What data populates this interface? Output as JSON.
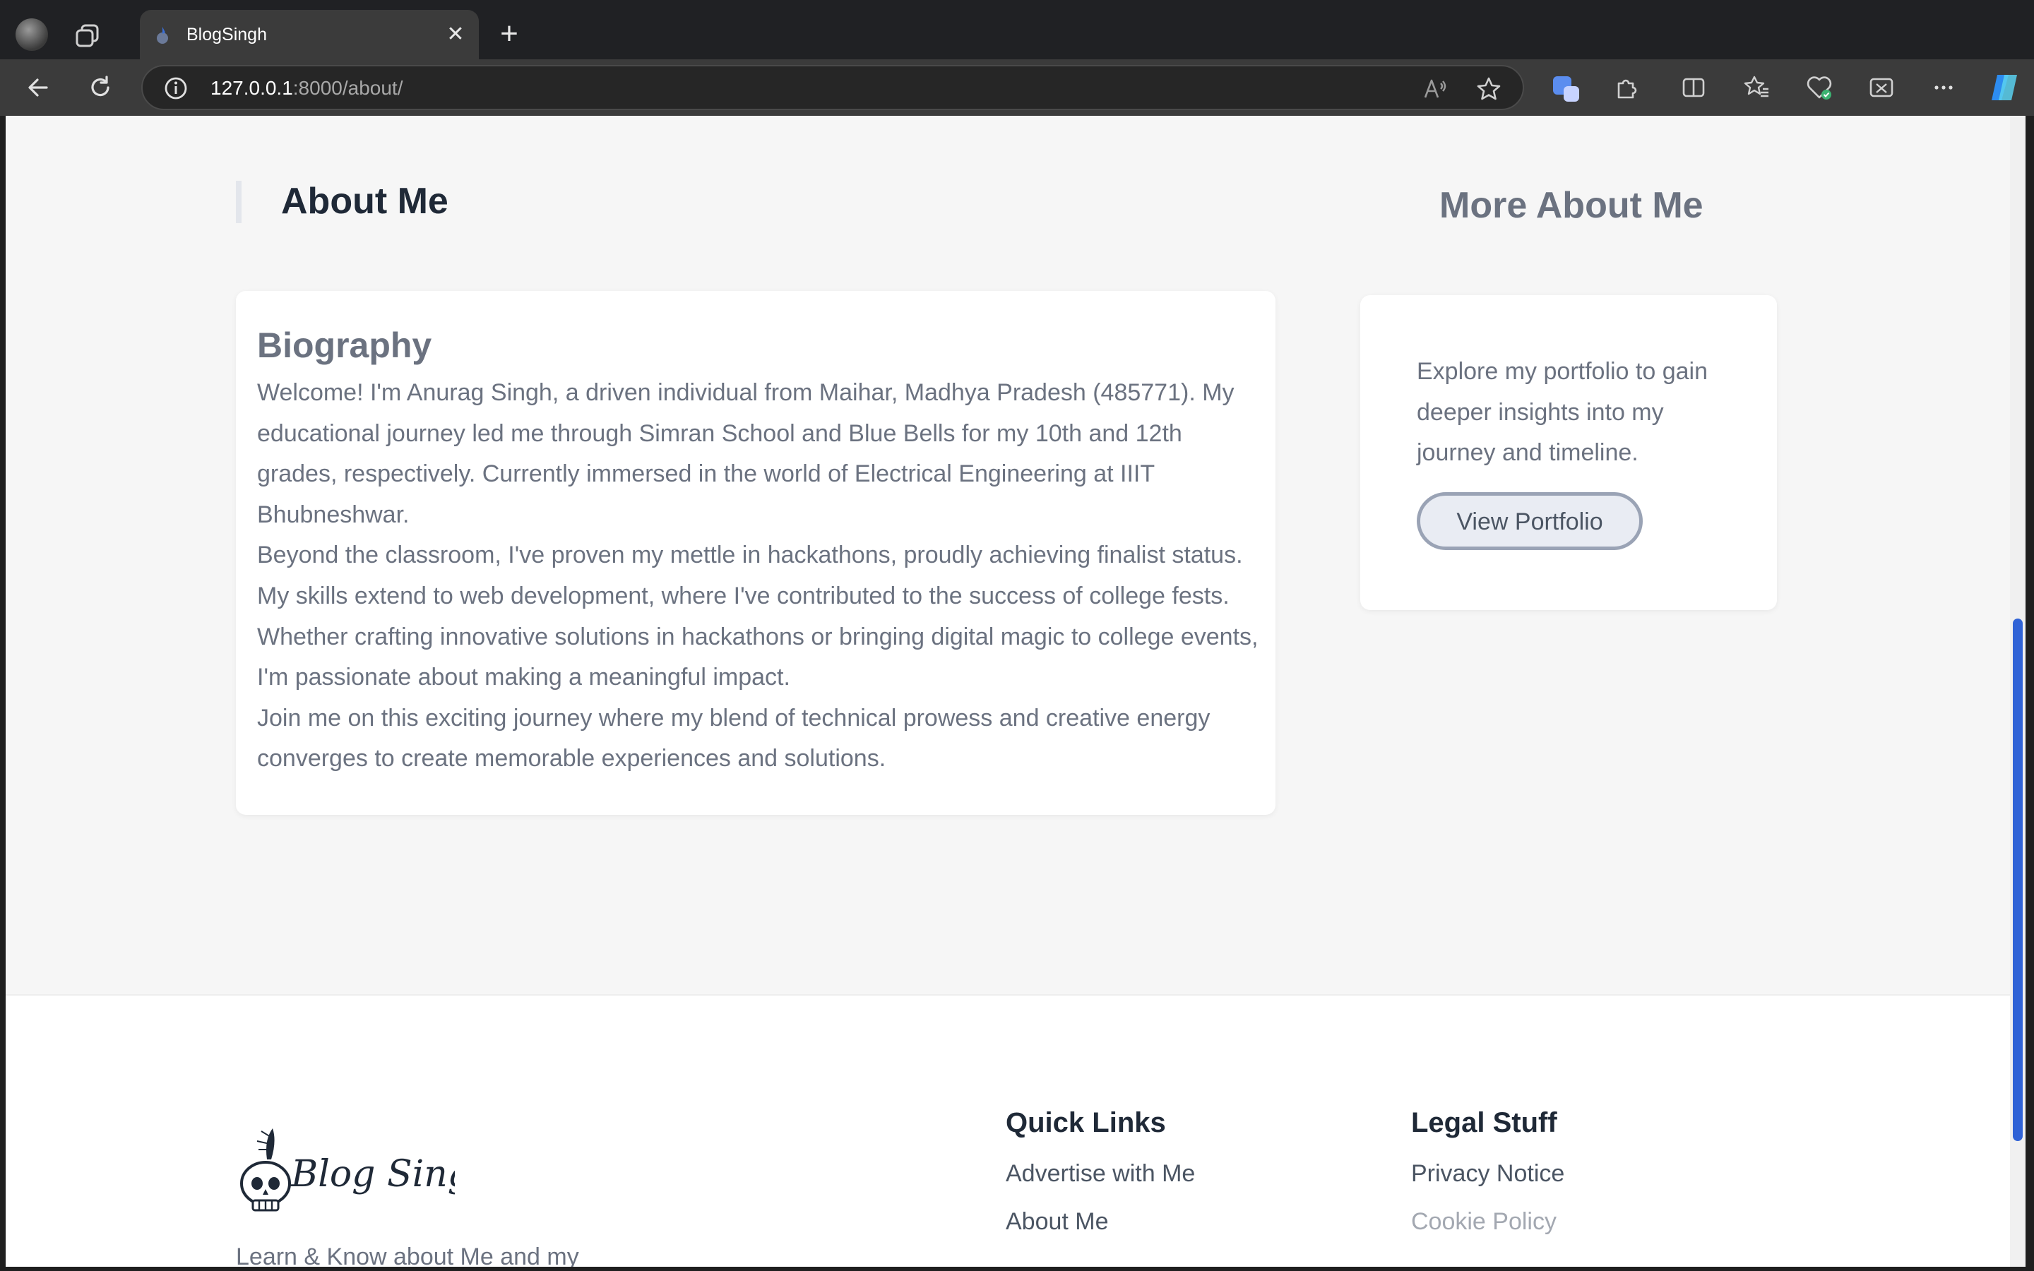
{
  "browser": {
    "tab_title": "BlogSingh",
    "tab_close": "✕",
    "new_tab": "+",
    "url_host": "127.0.0.1",
    "url_rest": ":8000/about/"
  },
  "page": {
    "heading": "About Me",
    "side_heading": "More About Me"
  },
  "biography": {
    "title": "Biography",
    "paragraphs": [
      "Welcome! I'm Anurag Singh, a driven individual from Maihar, Madhya Pradesh (485771). My educational journey led me through Simran School and Blue Bells for my 10th and 12th grades, respectively. Currently immersed in the world of Electrical Engineering at IIIT Bhubneshwar.",
      "Beyond the classroom, I've proven my mettle in hackathons, proudly achieving finalist status. My skills extend to web development, where I've contributed to the success of college fests. Whether crafting innovative solutions in hackathons or bringing digital magic to college events, I'm passionate about making a meaningful impact.",
      "Join me on this exciting journey where my blend of technical prowess and creative energy converges to create memorable experiences and solutions."
    ]
  },
  "portfolio": {
    "text": "Explore my portfolio to gain deeper insights into my journey and timeline.",
    "button_label": "View Portfolio"
  },
  "footer": {
    "logo_text": "Blog Singh",
    "tagline": "Learn & Know about Me and my",
    "quick_links": {
      "title": "Quick Links",
      "items": [
        "Advertise with Me",
        "About Me"
      ]
    },
    "legal": {
      "title": "Legal Stuff",
      "items": [
        "Privacy Notice",
        "Cookie Policy"
      ]
    }
  },
  "colors": {
    "accent_scrollbar": "#2f62d6",
    "heading": "#1f2937",
    "muted_text": "#6b7280"
  }
}
